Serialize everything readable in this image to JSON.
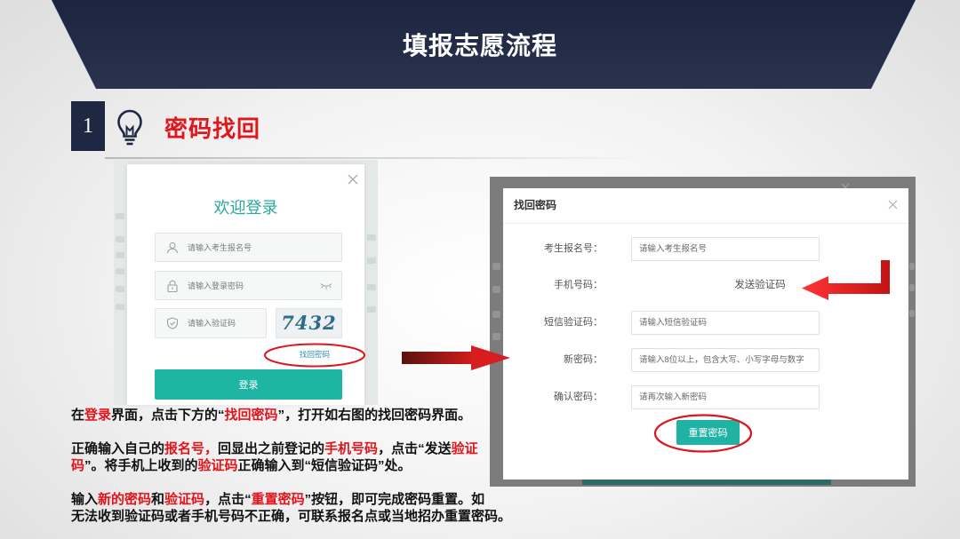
{
  "slide": {
    "title": "填报志愿流程",
    "section": {
      "number": "1",
      "title": "密码找回",
      "icon": "lightbulb-icon"
    }
  },
  "colors": {
    "navy": "#1e2842",
    "highlight_red": "#e3141b",
    "teal": "#1fb5a4",
    "arrow_red": "#d21c1c"
  },
  "login_dialog": {
    "title": "欢迎登录",
    "close_icon": "close-icon",
    "fields": {
      "candidate_id": {
        "placeholder": "请输入考生报名号",
        "icon": "user-icon"
      },
      "password": {
        "placeholder": "请输入登录密码",
        "icon": "lock-icon",
        "toggle_icon": "eye-closed-icon"
      },
      "captcha": {
        "placeholder": "请输入验证码",
        "icon": "shield-check-icon",
        "image_text": "7432"
      }
    },
    "forgot_password_link": "找回密码",
    "login_button": "登录"
  },
  "reset_dialog": {
    "title": "找回密码",
    "close_icon": "close-icon",
    "rows": [
      {
        "label": "考生报名号：",
        "placeholder": "请输入考生报名号"
      },
      {
        "label": "手机号码：",
        "action": "发送验证码"
      },
      {
        "label": "短信验证码：",
        "placeholder": "请输入短信验证码"
      },
      {
        "label": "新密码：",
        "placeholder": "请输入8位以上，包含大写、小写字母与数字"
      },
      {
        "label": "确认密码：",
        "placeholder": "请再次输入新密码"
      }
    ],
    "submit_button": "重置密码"
  },
  "instructions": {
    "paragraphs": [
      {
        "lines": [
          [
            {
              "text": "在",
              "highlight": false
            },
            {
              "text": "登录",
              "highlight": true
            },
            {
              "text": "界面，点击下方的“",
              "highlight": false
            },
            {
              "text": "找回密码",
              "highlight": true
            },
            {
              "text": "”，打开如右图的找回密码界面。",
              "highlight": false
            }
          ]
        ]
      },
      {
        "lines": [
          [
            {
              "text": "正确输入自己的",
              "highlight": false
            },
            {
              "text": "报名号，",
              "highlight": true
            },
            {
              "text": "回显出之前登记的",
              "highlight": false
            },
            {
              "text": "手机号码",
              "highlight": true
            },
            {
              "text": "，点击“发送",
              "highlight": false
            },
            {
              "text": "验证",
              "highlight": true
            }
          ],
          [
            {
              "text": "码",
              "highlight": true
            },
            {
              "text": "”。将手机上收到的",
              "highlight": false
            },
            {
              "text": "验证码",
              "highlight": true
            },
            {
              "text": "正确输入到“短信验证码”处。",
              "highlight": false
            }
          ]
        ]
      },
      {
        "lines": [
          [
            {
              "text": "输入",
              "highlight": false
            },
            {
              "text": "新的密码",
              "highlight": true
            },
            {
              "text": "和",
              "highlight": false
            },
            {
              "text": "验证码",
              "highlight": true
            },
            {
              "text": "，点击“",
              "highlight": false
            },
            {
              "text": "重置密码",
              "highlight": true
            },
            {
              "text": "”按钮，即可完成密码重置。如",
              "highlight": false
            }
          ],
          [
            {
              "text": "无法收到验证码或者手机号码不正确，可联系报名点或当地招办重置密码。",
              "highlight": false
            }
          ]
        ]
      }
    ]
  }
}
